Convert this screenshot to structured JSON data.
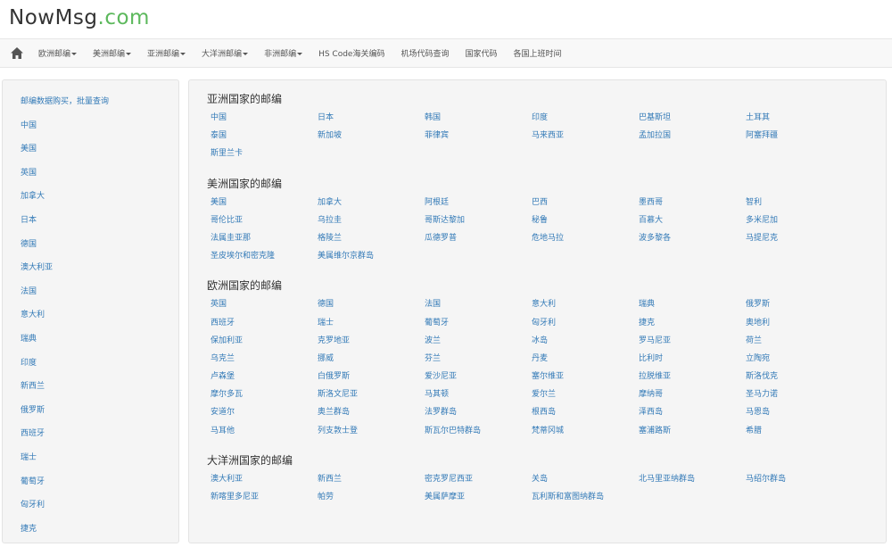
{
  "logo": {
    "main": "NowMsg",
    "dot": ".com"
  },
  "navbar": {
    "items": [
      {
        "label": "欧洲邮编",
        "dropdown": true
      },
      {
        "label": "美洲邮编",
        "dropdown": true
      },
      {
        "label": "亚洲邮编",
        "dropdown": true
      },
      {
        "label": "大洋洲邮编",
        "dropdown": true
      },
      {
        "label": "非洲邮编",
        "dropdown": true
      },
      {
        "label": "HS Code海关编码",
        "dropdown": false
      },
      {
        "label": "机场代码查询",
        "dropdown": false
      },
      {
        "label": "国家代码",
        "dropdown": false
      },
      {
        "label": "各国上班时间",
        "dropdown": false
      }
    ]
  },
  "sidebar": {
    "items": [
      "邮编数据购买，批量查询",
      "中国",
      "美国",
      "英国",
      "加拿大",
      "日本",
      "德国",
      "澳大利亚",
      "法国",
      "意大利",
      "瑞典",
      "印度",
      "新西兰",
      "俄罗斯",
      "西班牙",
      "瑞士",
      "葡萄牙",
      "匈牙利",
      "捷克"
    ]
  },
  "sections": [
    {
      "title": "亚洲国家的邮编",
      "countries": [
        "中国",
        "日本",
        "韩国",
        "印度",
        "巴基斯坦",
        "土耳其",
        "泰国",
        "新加坡",
        "菲律宾",
        "马来西亚",
        "孟加拉国",
        "阿塞拜疆",
        "斯里兰卡"
      ]
    },
    {
      "title": "美洲国家的邮编",
      "countries": [
        "美国",
        "加拿大",
        "阿根廷",
        "巴西",
        "墨西哥",
        "智利",
        "哥伦比亚",
        "乌拉圭",
        "哥斯达黎加",
        "秘鲁",
        "百慕大",
        "多米尼加",
        "法属圭亚那",
        "格陵兰",
        "瓜德罗普",
        "危地马拉",
        "波多黎各",
        "马提尼克",
        "圣皮埃尔和密克隆",
        "美属维尔京群岛"
      ]
    },
    {
      "title": "欧洲国家的邮编",
      "countries": [
        "英国",
        "德国",
        "法国",
        "意大利",
        "瑞典",
        "俄罗斯",
        "西班牙",
        "瑞士",
        "葡萄牙",
        "匈牙利",
        "捷克",
        "奥地利",
        "保加利亚",
        "克罗地亚",
        "波兰",
        "冰岛",
        "罗马尼亚",
        "荷兰",
        "乌克兰",
        "挪威",
        "芬兰",
        "丹麦",
        "比利时",
        "立陶宛",
        "卢森堡",
        "白俄罗斯",
        "爱沙尼亚",
        "塞尔维亚",
        "拉脱维亚",
        "斯洛伐克",
        "摩尔多瓦",
        "斯洛文尼亚",
        "马其顿",
        "爱尔兰",
        "摩纳哥",
        "圣马力诺",
        "安道尔",
        "奥兰群岛",
        "法罗群岛",
        "根西岛",
        "泽西岛",
        "马恩岛",
        "马耳他",
        "列支敦士登",
        "斯瓦尔巴特群岛",
        "梵蒂冈城",
        "塞浦路斯",
        "希腊"
      ]
    },
    {
      "title": "大洋洲国家的邮编",
      "countries": [
        "澳大利亚",
        "新西兰",
        "密克罗尼西亚",
        "关岛",
        "北马里亚纳群岛",
        "马绍尔群岛",
        "新喀里多尼亚",
        "帕劳",
        "美属萨摩亚",
        "瓦利斯和富图纳群岛"
      ]
    }
  ]
}
